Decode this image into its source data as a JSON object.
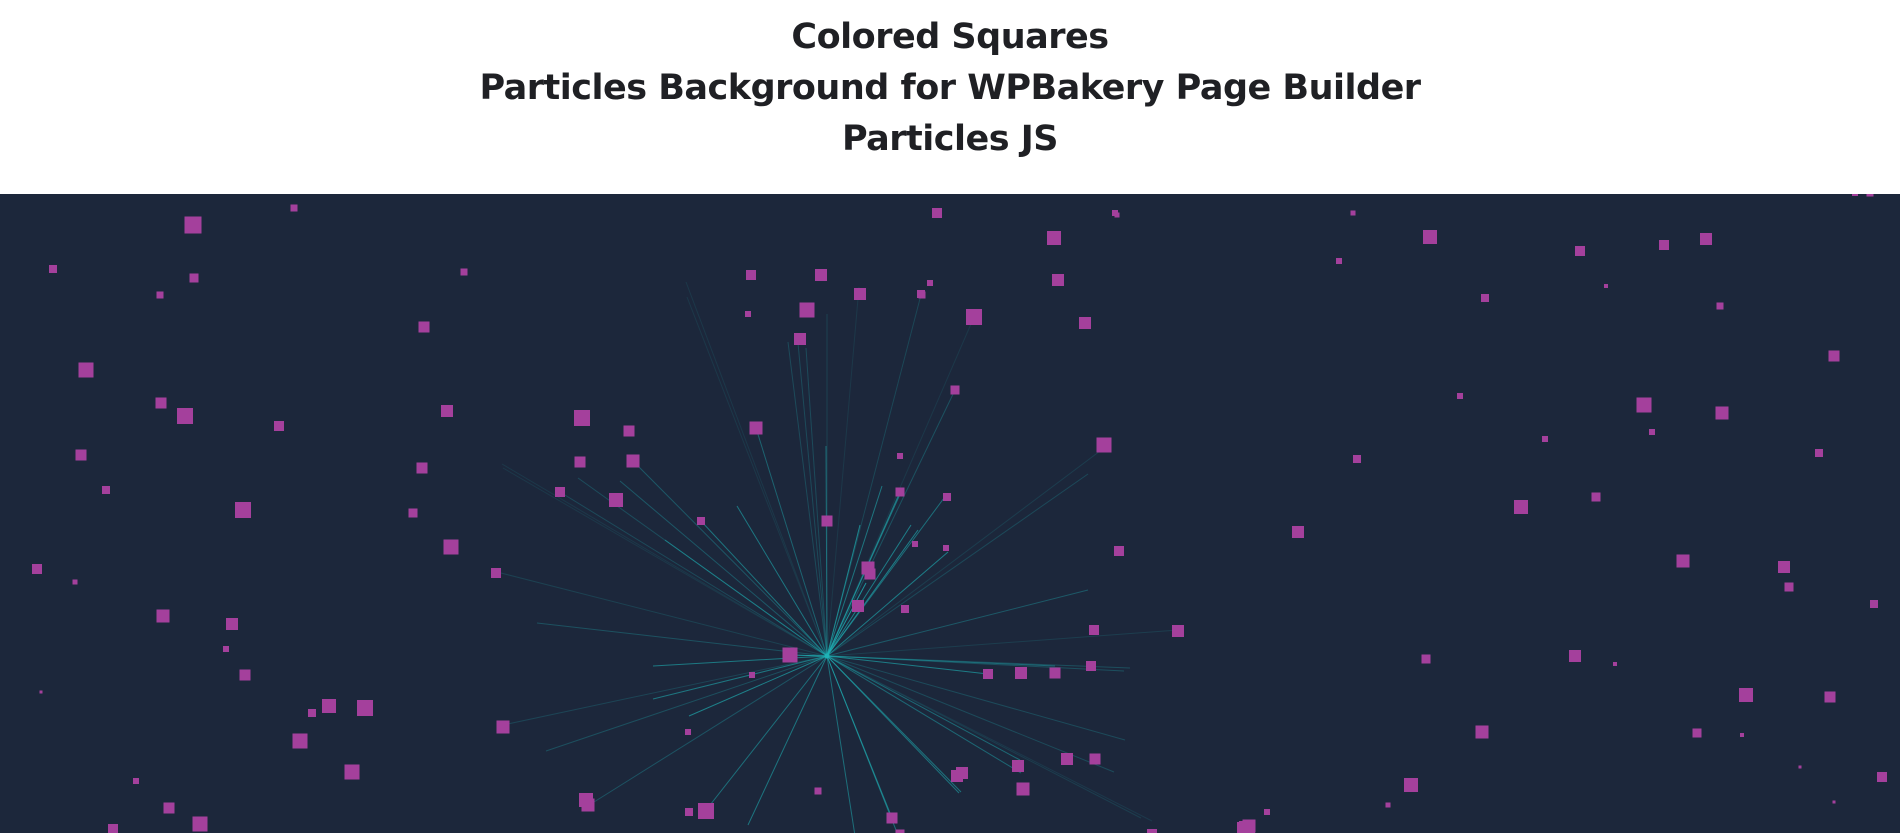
{
  "header": {
    "line1": "Colored Squares",
    "line2": "Particles Background for WPBakery Page Builder",
    "line3": "Particles JS"
  },
  "particles": {
    "background_color": "#1c273b",
    "particle_color": "#a4409c",
    "link_color": "#1fb2b6",
    "particle_shape": "square"
  }
}
